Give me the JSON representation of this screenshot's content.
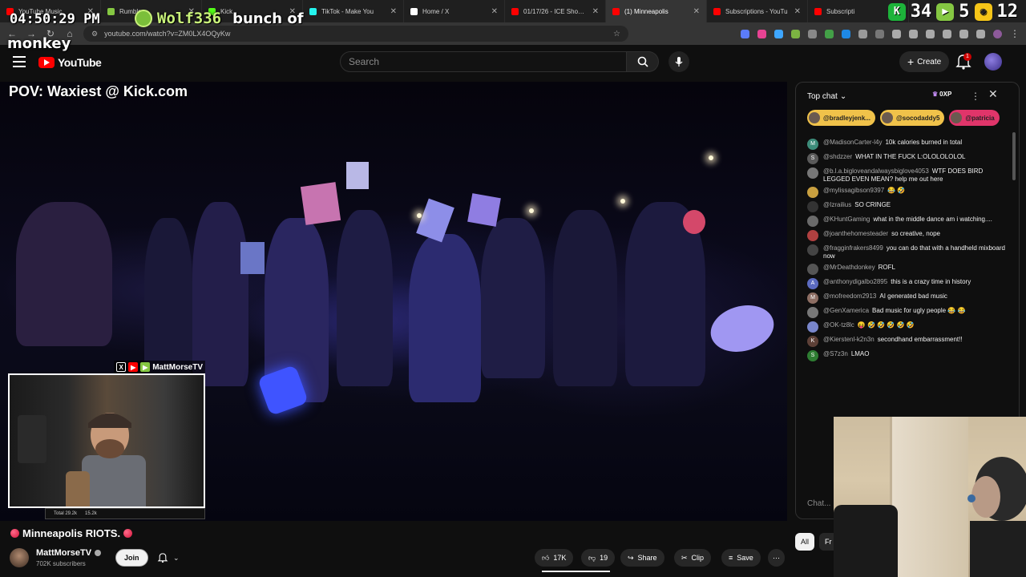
{
  "browser": {
    "tabs": [
      {
        "label": "YouTube Music",
        "color": "#ff0000",
        "active": false
      },
      {
        "label": "Rumble",
        "color": "#85c742",
        "active": false
      },
      {
        "label": "Kick",
        "color": "#53fc18",
        "active": false
      },
      {
        "label": "TikTok - Make You",
        "color": "#25f4ee",
        "active": false
      },
      {
        "label": "Home / X",
        "color": "#ffffff",
        "active": false
      },
      {
        "label": "01/17/26 - ICE Shootin",
        "color": "#ff0000",
        "active": false
      },
      {
        "label": "(1) Minneapolis",
        "color": "#ff0000",
        "active": true
      },
      {
        "label": "Subscriptions - YouTu",
        "color": "#ff0000",
        "active": false
      },
      {
        "label": "Subscripti",
        "color": "#ff0000",
        "active": false
      }
    ],
    "url": "youtube.com/watch?v=ZM0LX4OQyKw"
  },
  "stream_overlay": {
    "clock": "04:50:29 PM",
    "username": "Wolf336",
    "message_line1": "bunch of",
    "message_line2": "monkey",
    "stat1": "34",
    "stat2": "5",
    "stat3": "12"
  },
  "youtube": {
    "logo_text": "YouTube",
    "search_placeholder": "Search",
    "create_label": "Create",
    "notification_count": "1"
  },
  "video": {
    "overlay_title": "POV: Waxiest @ Kick.com",
    "pip_handle": "MattMorseTV",
    "pip_stats": [
      "Total 29.2k",
      "15.2k"
    ]
  },
  "video_info": {
    "title": "Minneapolis RIOTS.",
    "channel_name": "MattMorseTV",
    "subscribers": "702K subscribers",
    "join_label": "Join",
    "likes": "17K",
    "dislikes": "19",
    "share_label": "Share",
    "clip_label": "Clip",
    "save_label": "Save"
  },
  "chat": {
    "header_label": "Top chat",
    "xp_label": "0XP",
    "pinned": [
      {
        "name": "@bradleyjenk...",
        "color": "#f0c24a"
      },
      {
        "name": "@socodaddy5",
        "color": "#f0c24a"
      },
      {
        "name": "@patricia",
        "color": "#e0356a"
      }
    ],
    "messages": [
      {
        "user": "@MadisonCarter-l4y",
        "text": "10k calories burned in total",
        "color": "#3d8c7a",
        "initial": "M"
      },
      {
        "user": "@shdzzer",
        "text": "WHAT IN THE FUCK L:OLOLOLOLOL",
        "color": "#5a5a5a",
        "initial": "S"
      },
      {
        "user": "@b.l.a.bigloveandalwaysbiglove4053",
        "text": "WTF DOES BIRD LEGGED EVEN MEAN? help me out here",
        "color": "#777",
        "initial": ""
      },
      {
        "user": "@mylissagibson9397",
        "text": "😂 🤣",
        "color": "#c9a040",
        "initial": ""
      },
      {
        "user": "@Izrailius",
        "text": "SO CRINGE",
        "color": "#333",
        "initial": ""
      },
      {
        "user": "@KHuntGaming",
        "text": "what in the middle dance am i watching....",
        "color": "#6a6a6a",
        "initial": ""
      },
      {
        "user": "@joanthehomesteader",
        "text": "so creative, nope",
        "color": "#b04040",
        "initial": ""
      },
      {
        "user": "@fragginfrakers8499",
        "text": "you can do that with a handheld mixboard now",
        "color": "#444",
        "initial": ""
      },
      {
        "user": "@MrDeathdonkey",
        "text": "ROFL",
        "color": "#555",
        "initial": ""
      },
      {
        "user": "@anthonydigalbo2895",
        "text": "this is a crazy time in history",
        "color": "#5c6bc0",
        "initial": "A"
      },
      {
        "user": "@mofreedom2913",
        "text": "AI generated bad music",
        "color": "#8d6e63",
        "initial": "M"
      },
      {
        "user": "@GenXamerica",
        "text": "Bad music for ugly people 😂 😂",
        "color": "#777",
        "initial": ""
      },
      {
        "user": "@OK-tz8lc",
        "text": "😝 🤣 🤣 🤣 🤣 🤣",
        "color": "#7986cb",
        "initial": ""
      },
      {
        "user": "@Kierstenl-k2n3n",
        "text": "secondhand embarrassment!!",
        "color": "#5d4037",
        "initial": "K"
      },
      {
        "user": "@S7z3n",
        "text": "LMAO",
        "color": "#2e7d32",
        "initial": "S"
      }
    ],
    "input_placeholder": "Chat..."
  },
  "filters": [
    "All",
    "Fr"
  ]
}
